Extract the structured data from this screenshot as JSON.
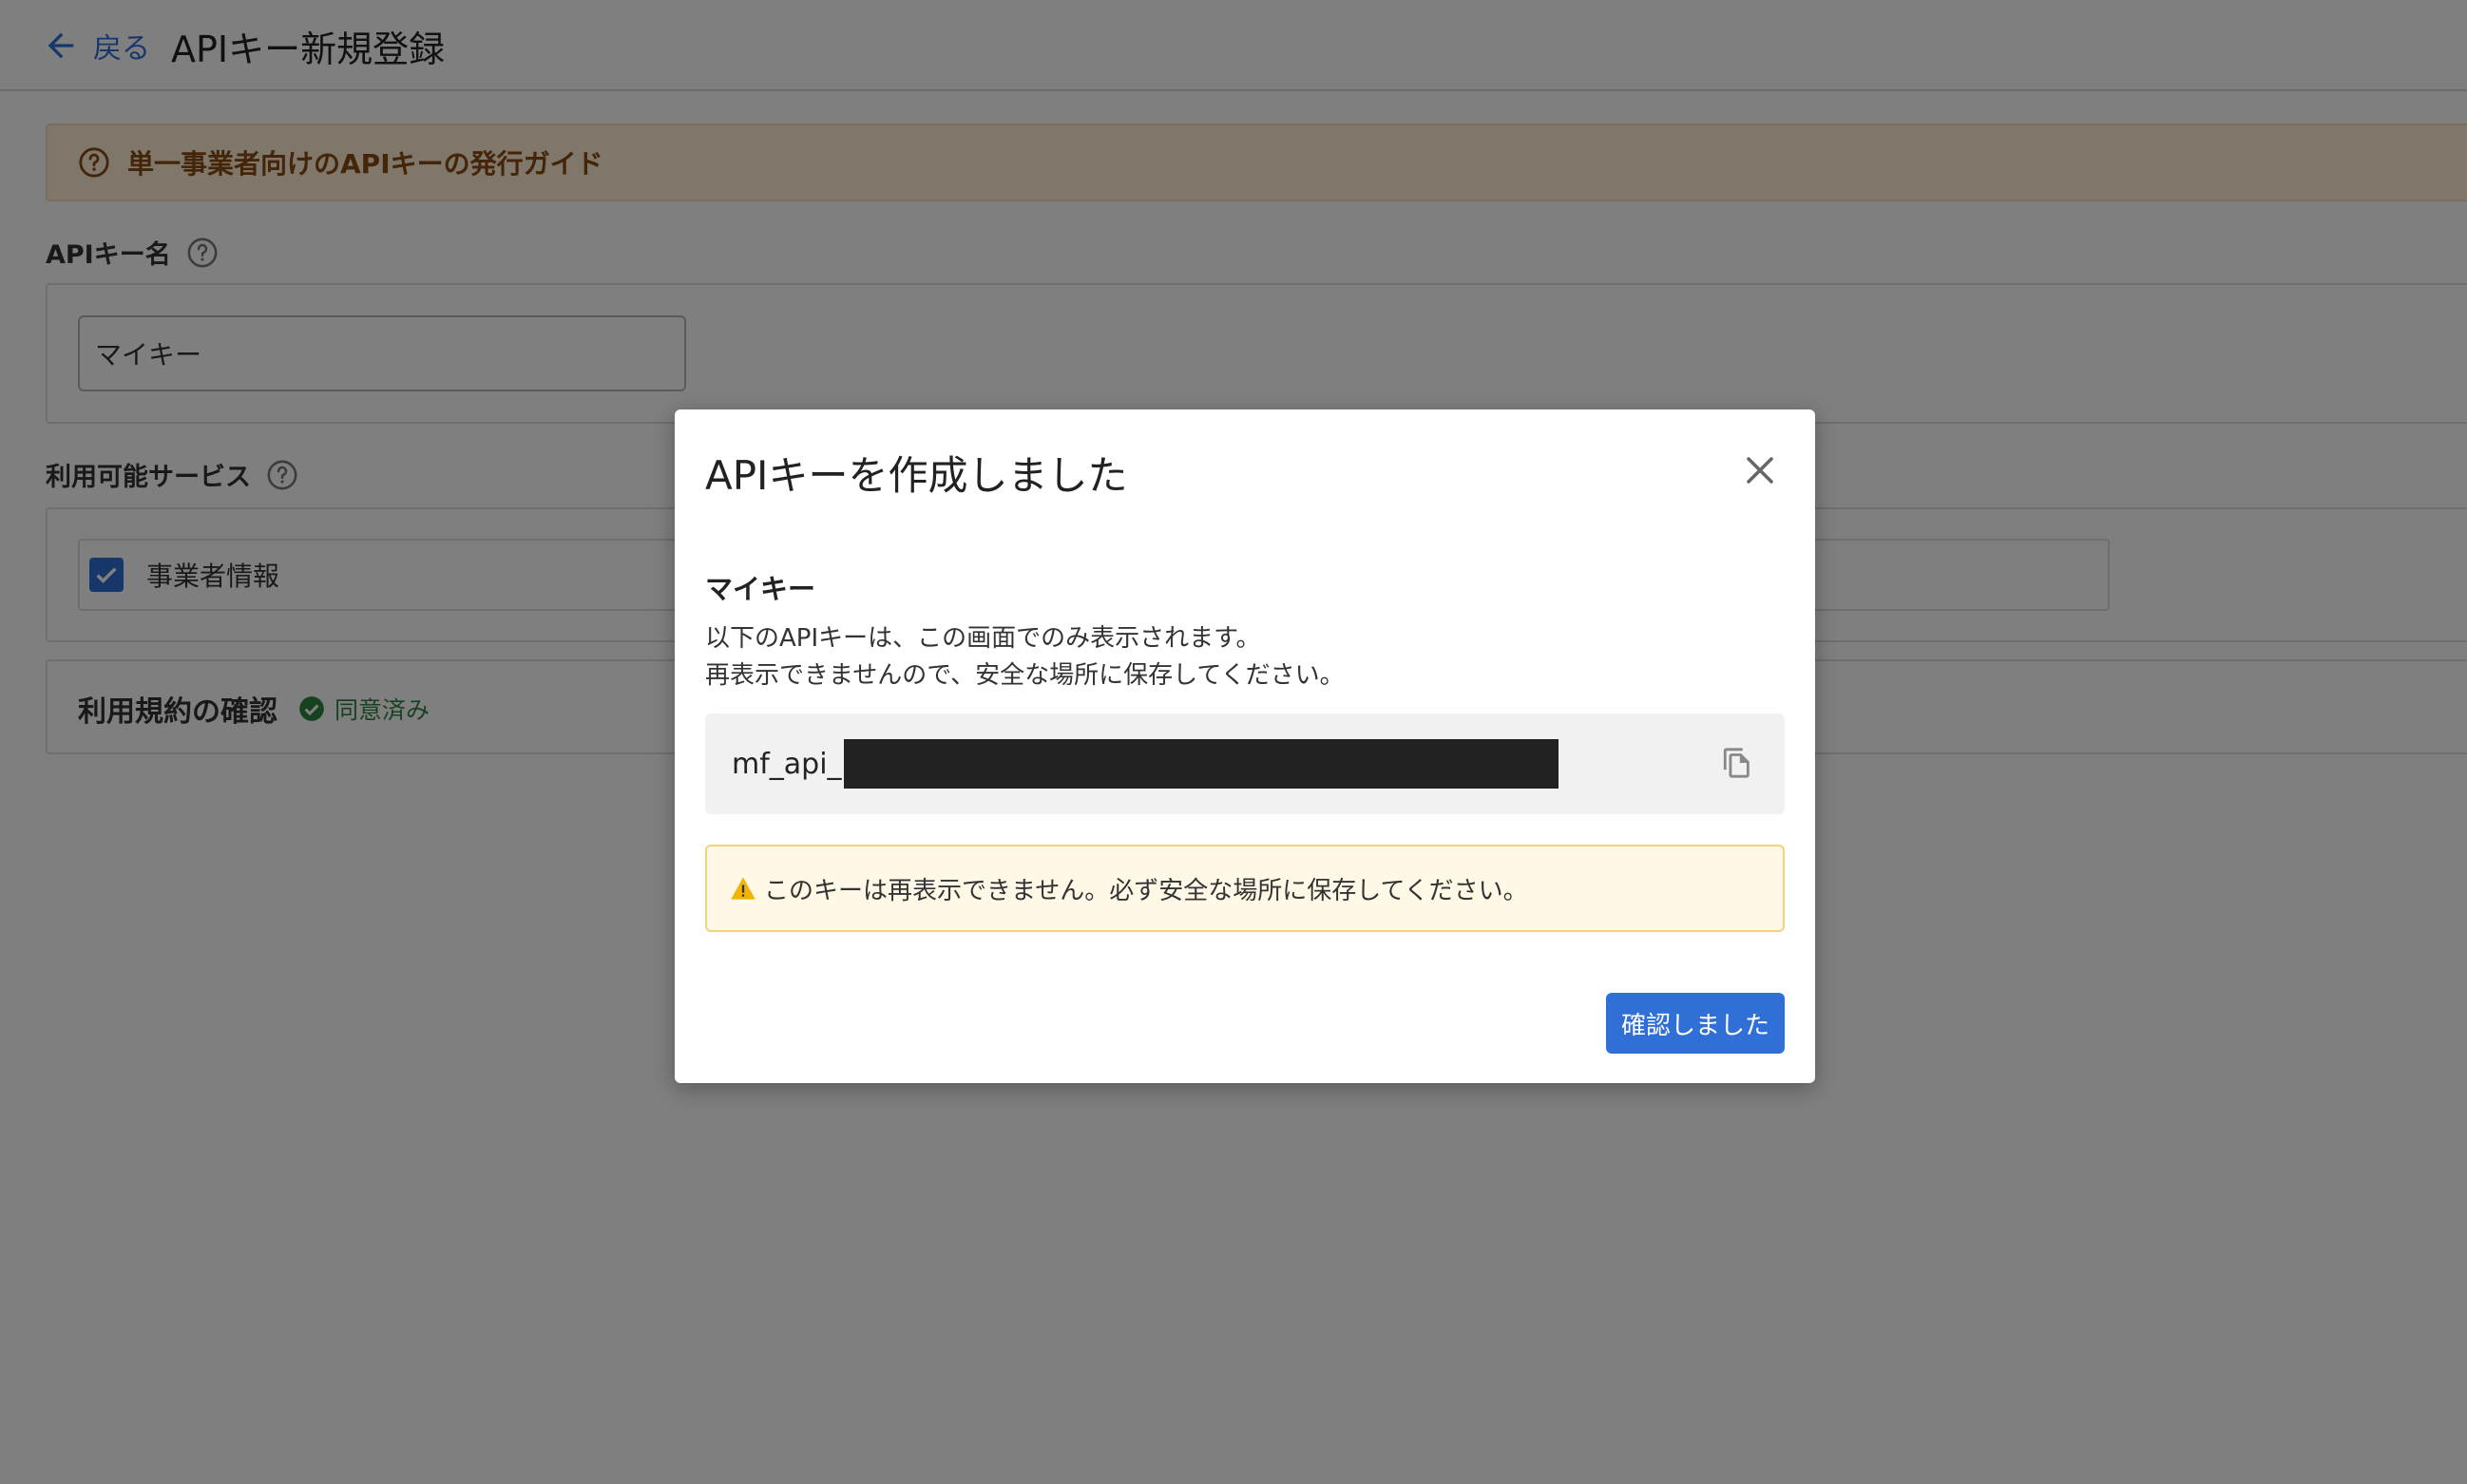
{
  "header": {
    "back_label": "戻る",
    "title": "APIキー新規登録"
  },
  "guide": {
    "label": "単一事業者向けのAPIキーの発行ガイド"
  },
  "form": {
    "api_key_name_label": "APIキー名",
    "api_key_name_value": "マイキー",
    "services_label": "利用可能サービス",
    "services": [
      {
        "label": "事業者情報",
        "checked": true
      }
    ],
    "terms_label": "利用規約の確認",
    "terms_status": "同意済み"
  },
  "modal": {
    "title": "APIキーを作成しました",
    "key_name": "マイキー",
    "description_line1": "以下のAPIキーは、この画面でのみ表示されます。",
    "description_line2": "再表示できませんので、安全な場所に保存してください。",
    "key_prefix": "mf_api_",
    "warning": "このキーは再表示できません。必ず安全な場所に保存してください。",
    "confirm_label": "確認しました"
  },
  "colors": {
    "accent": "#2f6fd6",
    "guide_bg": "#fdeed5",
    "warning_bg": "#fff8e6",
    "warning_border": "#f3d37a",
    "success": "#2e8540"
  }
}
